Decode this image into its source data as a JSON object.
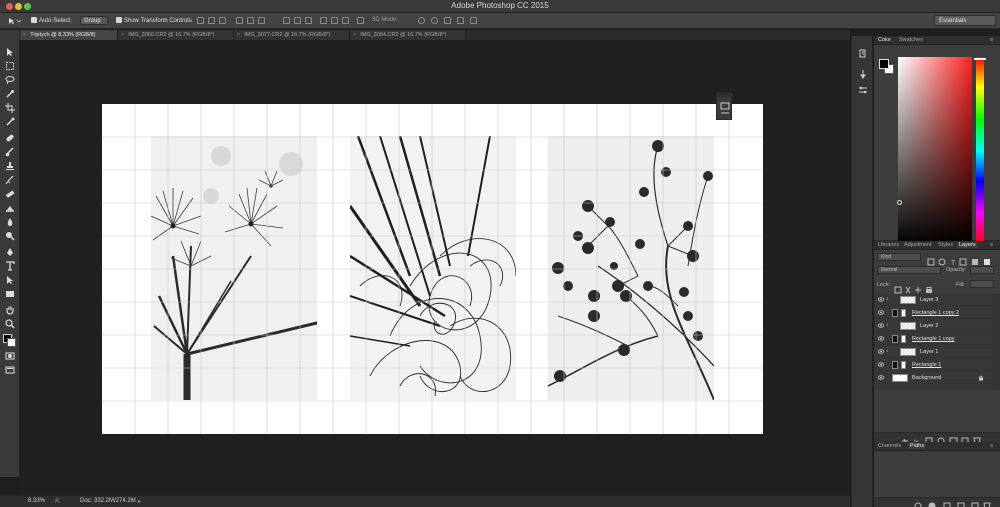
{
  "window": {
    "title": "Adobe Photoshop CC 2015"
  },
  "options_bar": {
    "auto_select_label": "Auto-Select:",
    "auto_select_value": "Group",
    "transform_label": "Show Transform Controls",
    "mode_3d_label": "3D Mode:",
    "workspace": "Essentials"
  },
  "tabs": [
    {
      "label": "Triptych @ 8.33% (RGB/8)",
      "active": true
    },
    {
      "label": "IMG_3060.CR2 @ 16.7% (RGB/8*)",
      "active": false
    },
    {
      "label": "IMG_3077.CR2 @ 16.7% (RGB/8*)",
      "active": false
    },
    {
      "label": "IMG_3094.CR2 @ 16.7% (RGB/8*)",
      "active": false
    }
  ],
  "status_bar": {
    "zoom": "8.33%",
    "doc": "Doc: 332.2M/274.2M"
  },
  "color_panel": {
    "tabs": [
      "Color",
      "Swatches"
    ],
    "foreground": "#000000",
    "background": "#ffffff",
    "hue": "#ff2020"
  },
  "layers_panel": {
    "tabs": [
      "Libraries",
      "Adjustment",
      "Styles",
      "Layers"
    ],
    "filter_kind": "Kind",
    "blend_mode": "Normal",
    "opacity_label": "Opacity:",
    "lock_label": "Lock:",
    "fill_label": "Fill:",
    "layers": [
      {
        "name": "Layer 3",
        "clipped": true,
        "kind": "pixel"
      },
      {
        "name": "Rectangle 1 copy 2",
        "clipped": false,
        "kind": "shape"
      },
      {
        "name": "Layer 2",
        "clipped": true,
        "kind": "pixel"
      },
      {
        "name": "Rectangle 1 copy",
        "clipped": false,
        "kind": "shape"
      },
      {
        "name": "Layer 1",
        "clipped": true,
        "kind": "pixel"
      },
      {
        "name": "Rectangle 1",
        "clipped": false,
        "kind": "shape"
      },
      {
        "name": "Background",
        "clipped": false,
        "kind": "background"
      }
    ]
  },
  "bottom_panel": {
    "tabs": [
      "Channels",
      "Paths"
    ]
  }
}
